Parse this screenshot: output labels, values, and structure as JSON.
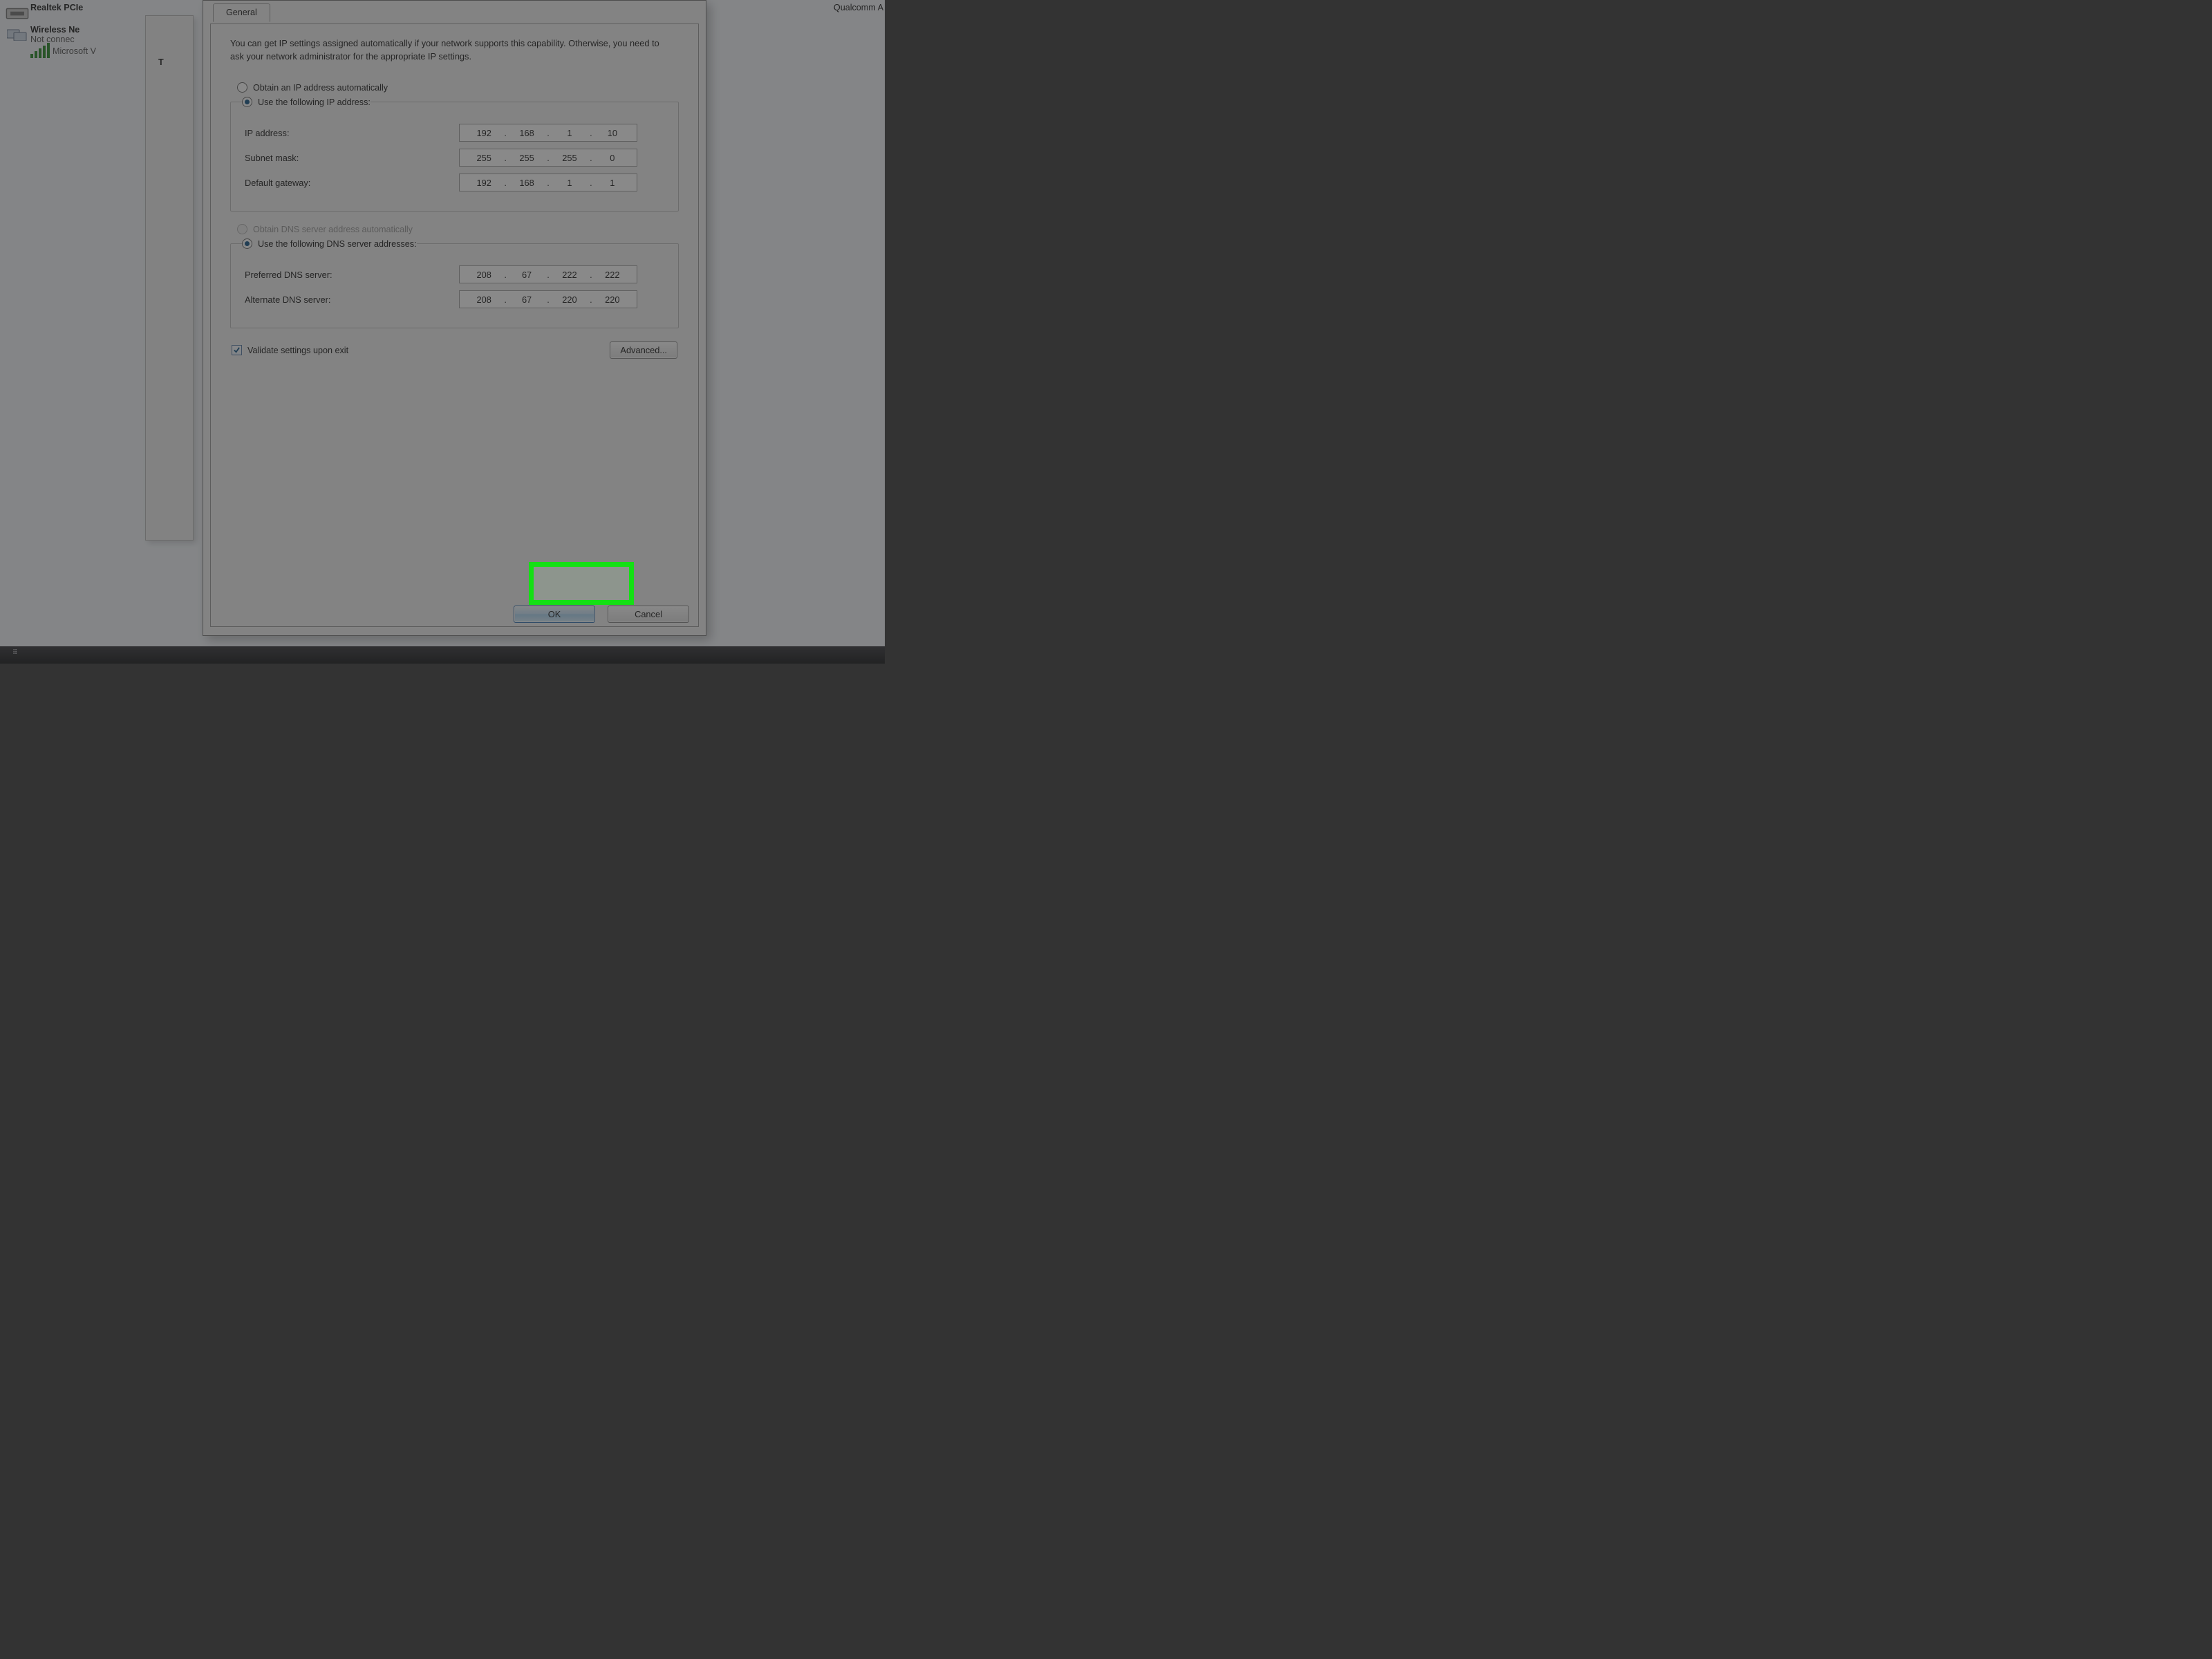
{
  "background": {
    "adapters": [
      {
        "title": "Realtek PCIe"
      },
      {
        "title": "Wireless Ne",
        "line2": "Not connec",
        "line3": "Microsoft V"
      }
    ],
    "right_label": "Qualcomm A",
    "inner_window_letter": "T"
  },
  "dialog": {
    "tab_label": "General",
    "intro": "You can get IP settings assigned automatically if your network supports this capability. Otherwise, you need to ask your network administrator for the appropriate IP settings.",
    "ip_section": {
      "radio_auto": "Obtain an IP address automatically",
      "radio_manual": "Use the following IP address:",
      "fields": {
        "ip_label": "IP address:",
        "ip_value": [
          "192",
          "168",
          "1",
          "10"
        ],
        "mask_label": "Subnet mask:",
        "mask_value": [
          "255",
          "255",
          "255",
          "0"
        ],
        "gw_label": "Default gateway:",
        "gw_value": [
          "192",
          "168",
          "1",
          "1"
        ]
      }
    },
    "dns_section": {
      "radio_auto": "Obtain DNS server address automatically",
      "radio_manual": "Use the following DNS server addresses:",
      "fields": {
        "preferred_label": "Preferred DNS server:",
        "preferred_value": [
          "208",
          "67",
          "222",
          "222"
        ],
        "alternate_label": "Alternate DNS server:",
        "alternate_value": [
          "208",
          "67",
          "220",
          "220"
        ]
      }
    },
    "validate_label": "Validate settings upon exit",
    "validate_checked": true,
    "advanced_label": "Advanced...",
    "ok_label": "OK",
    "cancel_label": "Cancel"
  }
}
